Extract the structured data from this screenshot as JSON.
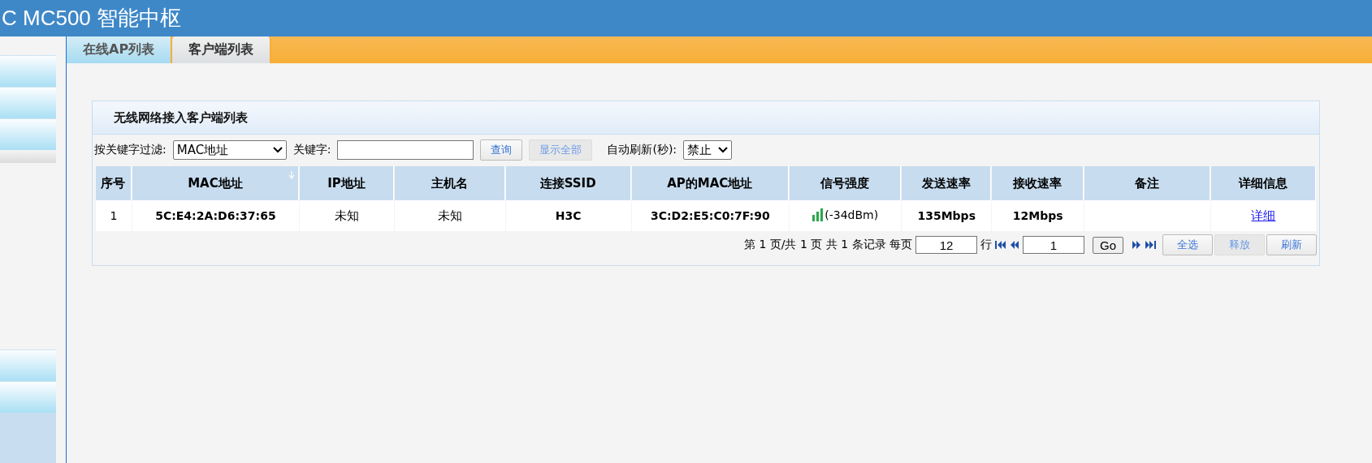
{
  "header": {
    "title": "C MC500 智能中枢"
  },
  "sidebar": {
    "items": [
      {
        "kind": "menu"
      },
      {
        "kind": "menu"
      },
      {
        "kind": "menu"
      },
      {
        "kind": "gap"
      },
      {
        "kind": "spacer"
      },
      {
        "kind": "menu"
      },
      {
        "kind": "menu"
      },
      {
        "kind": "fill"
      }
    ]
  },
  "tabs": [
    {
      "label": "在线AP列表",
      "selected": false
    },
    {
      "label": "客户端列表",
      "selected": true
    }
  ],
  "panel": {
    "title": "无线网络接入客户端列表",
    "filter": {
      "label": "按关键字过滤:",
      "field": "MAC地址",
      "keyword_label": "关键字:",
      "buttons": [
        {
          "label": "查询",
          "disabled": false
        },
        {
          "label": "显示全部",
          "disabled": true
        }
      ],
      "refresh_label": "自动刷新(秒):",
      "refresh_value": "禁止"
    },
    "table": {
      "columns": [
        {
          "label": "序号",
          "sorted": false
        },
        {
          "label": "MAC地址",
          "sorted": true
        },
        {
          "label": "IP地址",
          "sorted": false
        },
        {
          "label": "主机名",
          "sorted": false
        },
        {
          "label": "连接SSID",
          "sorted": false
        },
        {
          "label": "AP的MAC地址",
          "sorted": false
        },
        {
          "label": "信号强度",
          "sorted": false
        },
        {
          "label": "发送速率",
          "sorted": false
        },
        {
          "label": "接收速率",
          "sorted": false
        },
        {
          "label": "备注",
          "sorted": false
        },
        {
          "label": "详细信息",
          "sorted": false
        }
      ],
      "rows": [
        {
          "index": "1",
          "mac": "5C:E4:2A:D6:37:65",
          "ip": "未知",
          "host": "未知",
          "ssid": "H3C",
          "ap_mac": "3C:D2:E5:C0:7F:90",
          "signal": "(-34dBm)",
          "tx": "135Mbps",
          "rx": "12Mbps",
          "detail": "详细"
        }
      ]
    },
    "pager": {
      "summary": "第 1 页/共 1 页 共 1 条记录 每页",
      "per_page": "12",
      "rows_label": "行",
      "page": "1",
      "go": "Go",
      "buttons": [
        {
          "label": "全选",
          "disabled": false
        },
        {
          "label": "释放",
          "disabled": true
        },
        {
          "label": "刷新",
          "disabled": false
        }
      ]
    }
  }
}
